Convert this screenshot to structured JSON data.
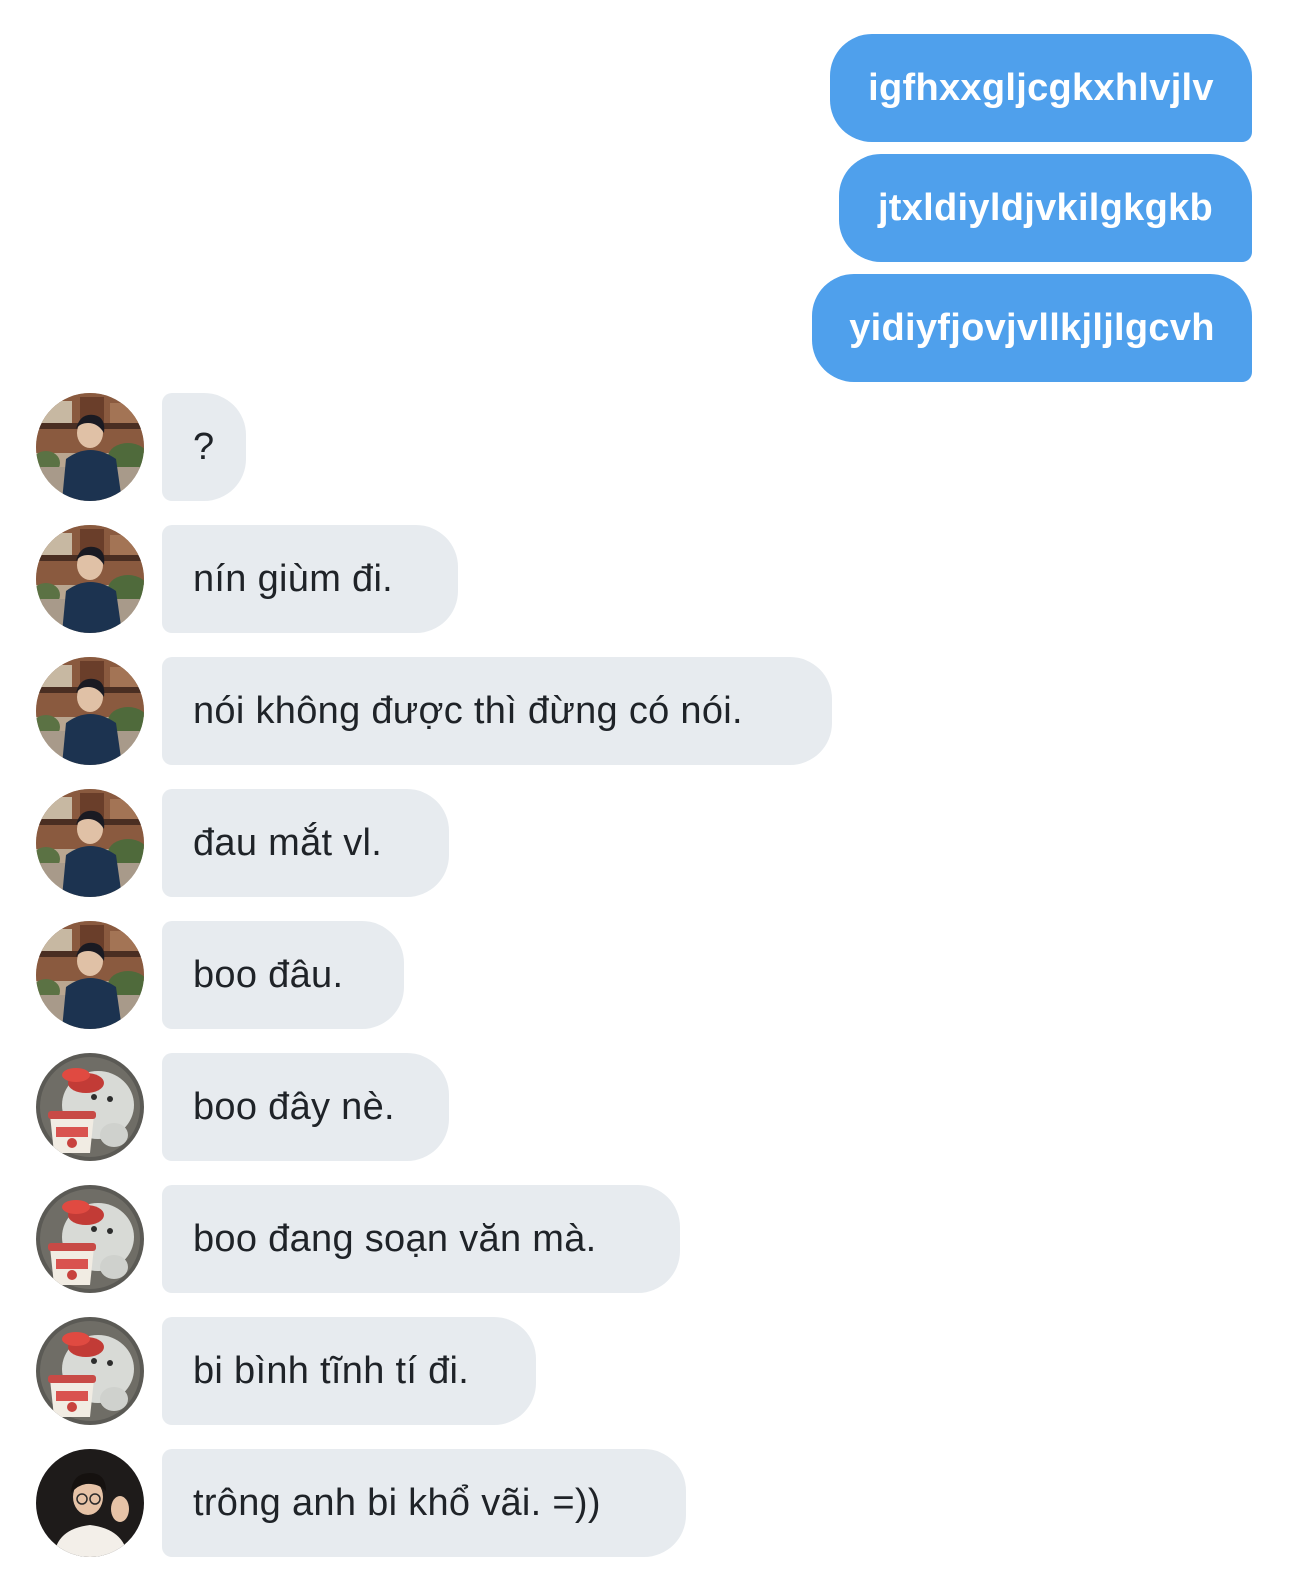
{
  "conversation": {
    "sent": [
      {
        "text": "igfhxxgljcgkxhlvjlv"
      },
      {
        "text": "jtxldiyldjvkilgkgkb"
      },
      {
        "text": "yidiyfjovjvllkjljlgcvh"
      }
    ],
    "received": [
      {
        "text": "?",
        "avatar": "person-street-avatar"
      },
      {
        "text": "nín giùm đi.",
        "avatar": "person-street-avatar"
      },
      {
        "text": "nói không được thì đừng có nói.",
        "avatar": "person-street-avatar"
      },
      {
        "text": "đau mắt vl.",
        "avatar": "person-street-avatar"
      },
      {
        "text": "boo đâu.",
        "avatar": "person-street-avatar"
      },
      {
        "text": "boo đây nè.",
        "avatar": "cartoon-bear-avatar"
      },
      {
        "text": "boo đang soạn văn mà.",
        "avatar": "cartoon-bear-avatar"
      },
      {
        "text": "bi bình tĩnh tí đi.",
        "avatar": "cartoon-bear-avatar"
      },
      {
        "text": "trông anh bi khổ vãi. =))",
        "avatar": "person-portrait-avatar"
      }
    ]
  },
  "colors": {
    "sent_bubble": "#4fa0ec",
    "received_bubble": "#e7ebef",
    "received_text": "#1f2328"
  }
}
